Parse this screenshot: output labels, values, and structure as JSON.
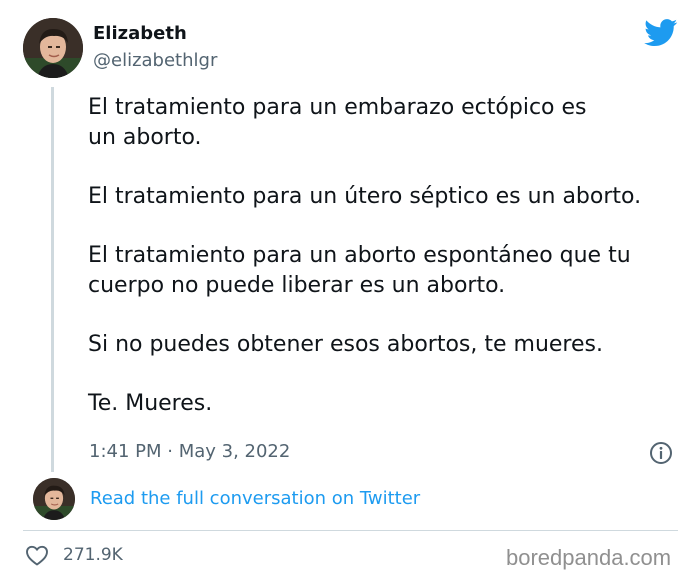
{
  "tweet": {
    "author": {
      "name": "Elizabeth",
      "handle": "@elizabethlgr"
    },
    "paragraphs": [
      {
        "lines": [
          "El tratamiento para un embarazo ectópico es",
          "un aborto."
        ]
      },
      {
        "lines": [
          "El tratamiento para un útero séptico es un aborto."
        ]
      },
      {
        "lines": [
          "El tratamiento para un aborto espontáneo que tu",
          "cuerpo no puede liberar es un aborto."
        ]
      },
      {
        "lines": [
          "Si no puedes obtener esos abortos, te mueres."
        ]
      },
      {
        "lines": [
          "Te. Mueres."
        ]
      }
    ],
    "timestamp": "1:41 PM · May 3, 2022",
    "read_link": "Read the full conversation on Twitter",
    "likes": "271.9K"
  },
  "watermark": "boredpanda.com",
  "colors": {
    "twitter_blue": "#1d9bf0",
    "text_primary": "#0f1419",
    "text_secondary": "#536471",
    "divider": "#cfd9de"
  },
  "icons": {
    "brand": "twitter-bird-icon",
    "info": "info-icon",
    "like": "heart-icon"
  }
}
